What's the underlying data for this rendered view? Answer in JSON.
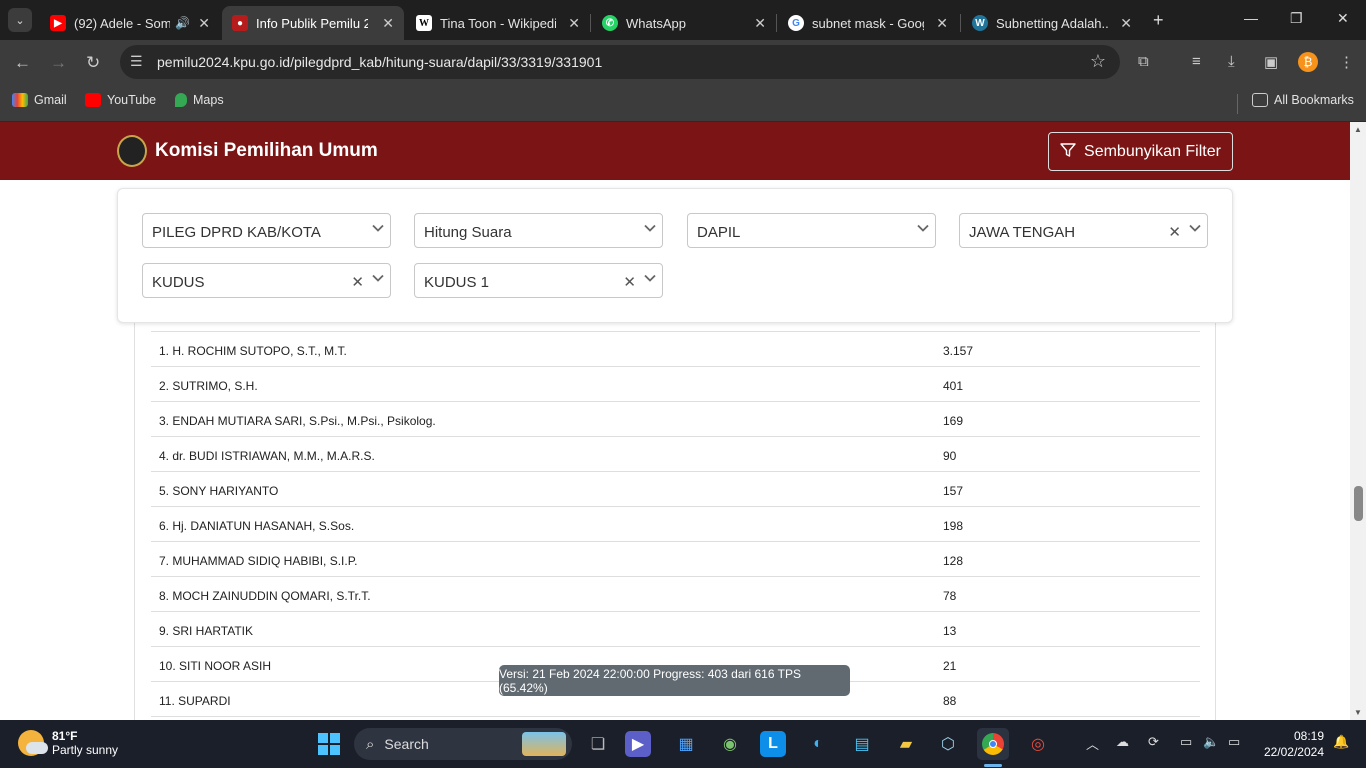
{
  "browser": {
    "tabs": [
      {
        "title": "(92) Adele - Some",
        "icon": "youtube-icon"
      },
      {
        "title": "Info Publik Pemilu 20",
        "icon": "kpu-icon"
      },
      {
        "title": "Tina Toon - Wikipedia",
        "icon": "wikipedia-icon"
      },
      {
        "title": "WhatsApp",
        "icon": "whatsapp-icon"
      },
      {
        "title": "subnet mask - Googl",
        "icon": "google-icon"
      },
      {
        "title": "Subnetting Adalah....",
        "icon": "wordpress-icon"
      }
    ],
    "url": "pemilu2024.kpu.go.id/pilegdprd_kab/hitung-suara/dapil/33/3319/331901",
    "bookmarks": [
      "Gmail",
      "YouTube",
      "Maps"
    ],
    "all_bookmarks": "All Bookmarks"
  },
  "site": {
    "brand": "Komisi Pemilihan Umum",
    "filter_button": "Sembunyikan Filter",
    "header_color": "#7b1414"
  },
  "filters": {
    "election": "PILEG DPRD KAB/KOTA",
    "mode": "Hitung Suara",
    "level": "DAPIL",
    "province": "JAWA TENGAH",
    "regency": "KUDUS",
    "dapil": "KUDUS 1"
  },
  "candidates": [
    {
      "name": "1. H. ROCHIM SUTOPO, S.T., M.T.",
      "votes": "3.157"
    },
    {
      "name": "2. SUTRIMO, S.H.",
      "votes": "401"
    },
    {
      "name": "3. ENDAH MUTIARA SARI, S.Psi., M.Psi., Psikolog.",
      "votes": "169"
    },
    {
      "name": "4. dr. BUDI ISTRIAWAN, M.M., M.A.R.S.",
      "votes": "90"
    },
    {
      "name": "5. SONY HARIYANTO",
      "votes": "157"
    },
    {
      "name": "6. Hj. DANIATUN HASANAH, S.Sos.",
      "votes": "198"
    },
    {
      "name": "7. MUHAMMAD SIDIQ HABIBI, S.I.P.",
      "votes": "128"
    },
    {
      "name": "8. MOCH ZAINUDDIN QOMARI, S.Tr.T.",
      "votes": "78"
    },
    {
      "name": "9. SRI HARTATIK",
      "votes": "13"
    },
    {
      "name": "10. SITI NOOR ASIH",
      "votes": "21"
    },
    {
      "name": "11. SUPARDI",
      "votes": "88"
    }
  ],
  "toast": "Versi: 21 Feb 2024 22:00:00 Progress: 403 dari 616 TPS (65.42%)",
  "taskbar": {
    "temperature": "81°F",
    "weather": "Partly sunny",
    "search_label": "Search",
    "time": "08:19",
    "date": "22/02/2024"
  }
}
